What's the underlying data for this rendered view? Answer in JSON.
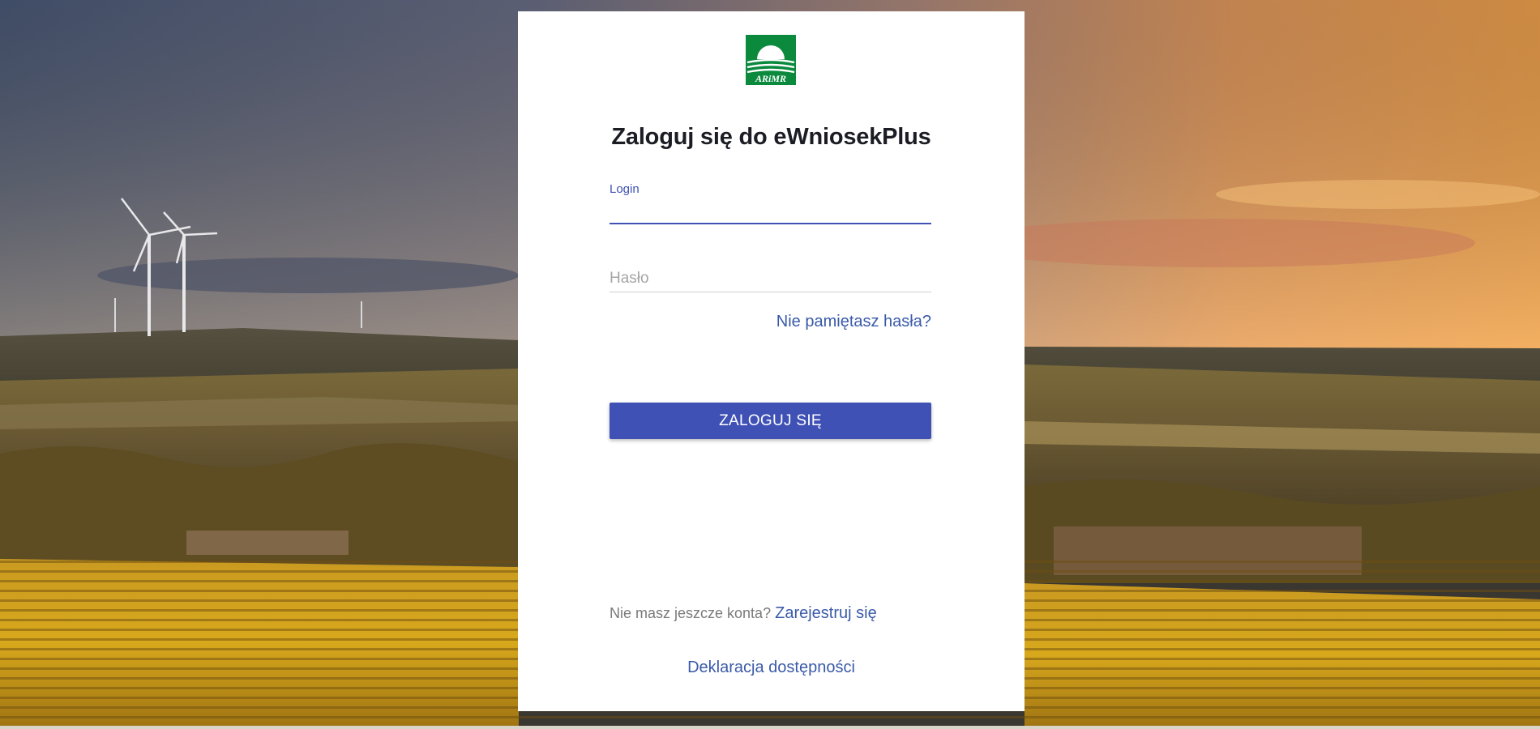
{
  "logo": {
    "text": "ARiMR",
    "color": "#0b8a3e"
  },
  "title": "Zaloguj się do eWniosekPlus",
  "login_field": {
    "label": "Login",
    "value": ""
  },
  "password_field": {
    "placeholder": "Hasło",
    "value": ""
  },
  "forgot_password": "Nie pamiętasz hasła?",
  "login_button": "ZALOGUJ SIĘ",
  "register": {
    "prompt": "Nie masz jeszcze konta?",
    "link": "Zarejestruj się"
  },
  "accessibility_declaration": "Deklaracja dostępności",
  "colors": {
    "accent": "#3f51b5",
    "link": "#3a5aa8",
    "card": "#ffffff"
  }
}
